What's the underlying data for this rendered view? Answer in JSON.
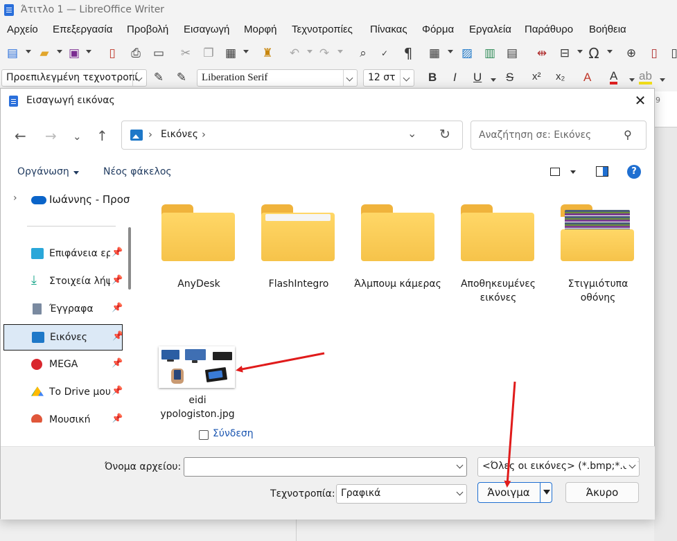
{
  "window": {
    "title": "Άτιτλο 1 — LibreOffice Writer"
  },
  "menu": [
    "Αρχείο",
    "Επεξεργασία",
    "Προβολή",
    "Εισαγωγή",
    "Μορφή",
    "Τεχνοτροπίες",
    "Πίνακας",
    "Φόρμα",
    "Εργαλεία",
    "Παράθυρο",
    "Βοήθεια"
  ],
  "formatting": {
    "paragraph_style": "Προεπιλεγμένη τεχνοτροπί",
    "font_name": "Liberation Serif",
    "font_size": "12 στ",
    "font_color": "#e02020",
    "highlight_color": "#f4e01a"
  },
  "ruler": {
    "number": "9"
  },
  "dialog": {
    "title": "Εισαγωγή εικόνας",
    "address": "Εικόνες",
    "search_placeholder": "Αναζήτηση σε: Εικόνες",
    "organize": "Οργάνωση",
    "new_folder": "Νέος φάκελος",
    "help": "?",
    "onedrive_label": "Ιωάννης - Προσ",
    "sidebar": [
      {
        "label": "Επιφάνεια εργ",
        "icon": "desktop-icon"
      },
      {
        "label": "Στοιχεία λήψ",
        "icon": "download-icon"
      },
      {
        "label": "Έγγραφα",
        "icon": "documents-icon"
      },
      {
        "label": "Εικόνες",
        "icon": "pictures-icon",
        "selected": true
      },
      {
        "label": "MEGA",
        "icon": "mega-icon"
      },
      {
        "label": "Το Drive μου",
        "icon": "google-drive-icon"
      },
      {
        "label": "Μουσική",
        "icon": "music-icon"
      }
    ],
    "folders": [
      "AnyDesk",
      "FlashIntegro",
      "Άλμπουμ κάμερας",
      "Αποθηκευμένες εικόνες",
      "Στιγμιότυπα οθόνης"
    ],
    "file": "eidi ypologiston.jpg",
    "link_label": "Σύνδεση",
    "filename_label": "Όνομα αρχείου:",
    "filename_value": "",
    "filter_value": "<Όλες οι εικόνες> (*.bmp;*.dxf;",
    "style_label": "Τεχνοτροπία:",
    "style_value": "Γραφικά",
    "open_button": "Άνοιγμα",
    "cancel_button": "Άκυρο",
    "accent_color": "#1f6fd1",
    "annotation_color": "#e01b1b"
  }
}
